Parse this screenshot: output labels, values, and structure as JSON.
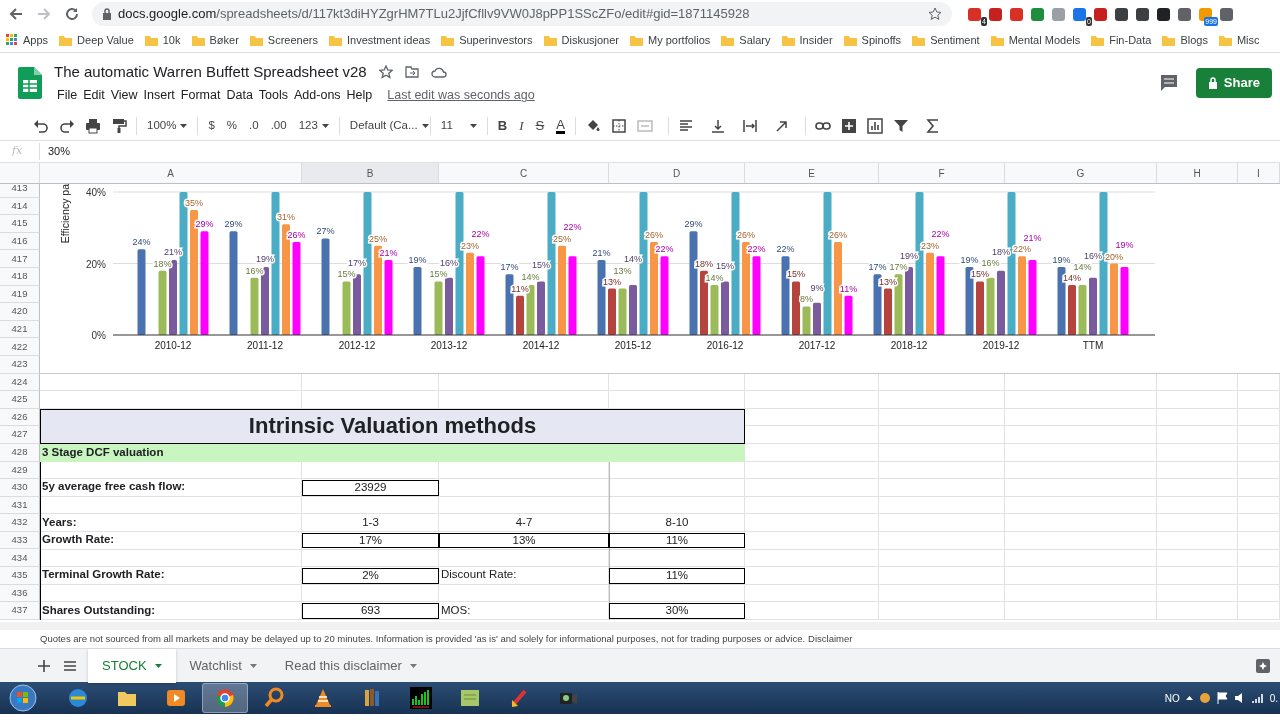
{
  "browser": {
    "url_host": "docs.google.com",
    "url_path": "/spreadsheets/d/117kt3diHYZgrHM7TLu2JjfCfllv9VW0J8pPP1SScZFo/edit#gid=1871145928",
    "extension_badges": [
      "4",
      "0",
      "999"
    ]
  },
  "bookmarks": [
    "Apps",
    "Deep Value",
    "10k",
    "Bøker",
    "Screeners",
    "Investment ideas",
    "Superinvestors",
    "Diskusjoner",
    "My portfolios",
    "Salary",
    "Insider",
    "Spinoffs",
    "Sentiment",
    "Mental Models",
    "Fin-Data",
    "Blogs",
    "Misc"
  ],
  "document": {
    "title": "The automatic Warren Buffett Spreadsheet v28",
    "last_edit": "Last edit was seconds ago",
    "share": "Share"
  },
  "menu": [
    "File",
    "Edit",
    "View",
    "Insert",
    "Format",
    "Data",
    "Tools",
    "Add-ons",
    "Help"
  ],
  "toolbar": {
    "zoom": "100%",
    "currency": "$",
    "percent": "%",
    "decrease_decimals": ".0",
    "increase_decimals": ".00",
    "number_format": "123",
    "font": "Default (Ca...",
    "font_size": "11",
    "bold": "B",
    "italic": "I",
    "strikethrough": "S",
    "text_color": "A"
  },
  "formula_bar": {
    "label": "fx",
    "value": "30%"
  },
  "columns": [
    {
      "label": "A",
      "selected": false
    },
    {
      "label": "B",
      "selected": true
    },
    {
      "label": "C",
      "selected": false
    },
    {
      "label": "D",
      "selected": false
    },
    {
      "label": "E",
      "selected": false
    },
    {
      "label": "F",
      "selected": false
    },
    {
      "label": "G",
      "selected": false
    },
    {
      "label": "H",
      "selected": false
    },
    {
      "label": "I",
      "selected": false
    }
  ],
  "rows": [
    {
      "number": "413"
    },
    {
      "number": "414"
    },
    {
      "number": "415"
    },
    {
      "number": "416"
    },
    {
      "number": "417"
    },
    {
      "number": "418"
    },
    {
      "number": "419"
    },
    {
      "number": "420"
    },
    {
      "number": "421"
    },
    {
      "number": "422"
    },
    {
      "number": "423"
    },
    {
      "number": "424"
    },
    {
      "number": "425"
    },
    {
      "number": "426",
      "cells": {
        "A": {
          "kind": "title",
          "text": "Intrinsic Valuation methods"
        }
      }
    },
    {
      "number": "427"
    },
    {
      "number": "428",
      "cells": {
        "A": {
          "kind": "section",
          "text": "3 Stage DCF valuation"
        }
      }
    },
    {
      "number": "429"
    },
    {
      "number": "430",
      "cells": {
        "A": {
          "kind": "label",
          "text": "5y average free cash flow:"
        },
        "B": {
          "kind": "boxed",
          "text": "23929"
        }
      }
    },
    {
      "number": "431"
    },
    {
      "number": "432",
      "cells": {
        "A": {
          "kind": "label",
          "text": "Years:"
        },
        "B": {
          "kind": "heading",
          "text": "1-3"
        },
        "C": {
          "kind": "heading",
          "text": "4-7"
        },
        "D": {
          "kind": "heading",
          "text": "8-10"
        }
      }
    },
    {
      "number": "433",
      "cells": {
        "A": {
          "kind": "label",
          "text": "Growth Rate:"
        },
        "B": {
          "kind": "boxed",
          "text": "17%"
        },
        "C": {
          "kind": "boxed",
          "text": "13%"
        },
        "D": {
          "kind": "boxed",
          "text": "11%"
        }
      }
    },
    {
      "number": "434"
    },
    {
      "number": "435",
      "cells": {
        "A": {
          "kind": "label",
          "text": "Terminal Growth Rate:"
        },
        "B": {
          "kind": "boxed",
          "text": "2%"
        },
        "C": {
          "kind": "plain",
          "text": "Discount Rate:"
        },
        "D": {
          "kind": "boxed",
          "text": "11%"
        }
      }
    },
    {
      "number": "436"
    },
    {
      "number": "437",
      "cells": {
        "A": {
          "kind": "label",
          "text": "Shares Outstanding:"
        },
        "B": {
          "kind": "boxed",
          "text": "693"
        },
        "C": {
          "kind": "plain",
          "text": "MOS:"
        },
        "D": {
          "kind": "boxed",
          "text": "30%"
        }
      }
    }
  ],
  "chart_data": {
    "type": "bar",
    "ylabel": "Efficiency pa",
    "categories": [
      "2010-12",
      "2011-12",
      "2012-12",
      "2013-12",
      "2014-12",
      "2015-12",
      "2016-12",
      "2017-12",
      "2018-12",
      "2019-12",
      "TTM"
    ],
    "ylim": [
      0,
      40
    ],
    "data_labels": true,
    "yticks": [
      {
        "value": 0,
        "label": "0%"
      },
      {
        "value": 20,
        "label": "20%"
      },
      {
        "value": 40,
        "label": "40%"
      }
    ],
    "series": [
      {
        "color": "#4a72b0",
        "values": [
          24,
          29,
          27,
          19,
          17,
          21,
          29,
          22,
          17,
          19,
          19
        ],
        "value_labels": [
          "24%",
          "29%",
          "27%",
          "19%",
          "17%",
          "21%",
          "29%",
          "22%",
          "17%",
          "19%",
          "19%"
        ]
      },
      {
        "color": "#b5443f",
        "values": [
          null,
          null,
          null,
          null,
          11,
          13,
          18,
          15,
          13,
          15,
          14
        ],
        "value_labels": [
          null,
          null,
          null,
          null,
          "11%",
          "13%",
          "18%",
          "15%",
          "13%",
          "15%",
          "14%"
        ]
      },
      {
        "color": "#9bbb59",
        "values": [
          18,
          16,
          15,
          15,
          14,
          13,
          14,
          8,
          17,
          16,
          14
        ],
        "value_labels": [
          "18%",
          "16%",
          "15%",
          "15%",
          "14%",
          "13%",
          "14%",
          "8%",
          "17%",
          "16%",
          "14%"
        ]
      },
      {
        "color": "#7a5c9e",
        "values": [
          21,
          19,
          17,
          16,
          15,
          14,
          15,
          9,
          19,
          18,
          16
        ],
        "value_labels": [
          "21%",
          "19%",
          "17%",
          "16%",
          "15%",
          "14%",
          "15%",
          "9%",
          "19%",
          "18%",
          "16%"
        ]
      },
      {
        "color": "#4bacc6",
        "values": [
          40,
          40,
          40,
          40,
          40,
          40,
          40,
          40,
          40,
          40,
          40
        ],
        "value_labels": [
          null,
          null,
          null,
          null,
          null,
          null,
          null,
          null,
          null,
          null,
          null
        ]
      },
      {
        "color": "#f79646",
        "values": [
          35,
          31,
          25,
          23,
          25,
          26,
          26,
          26,
          23,
          22,
          20
        ],
        "value_labels": [
          "35%",
          "31%",
          "25%",
          "23%",
          "25%",
          "26%",
          "26%",
          "26%",
          "23%",
          "22%",
          "20%"
        ]
      },
      {
        "color": "#ff00ff",
        "values": [
          29,
          26,
          21,
          22,
          22,
          22,
          22,
          11,
          22,
          21,
          19
        ],
        "value_labels": [
          "29%",
          "26%",
          "21%",
          "22%",
          "22%",
          "22%",
          "22%",
          "11%",
          "22%",
          "21%",
          "19%"
        ]
      }
    ]
  },
  "footer": {
    "notice": "Quotes are not sourced from all markets and may be delayed up to 20 minutes. Information is provided 'as is' and solely for informational purposes, not for trading purposes or advice.",
    "link": "Disclaimer"
  },
  "sheet_tabs": [
    {
      "label": "STOCK",
      "selected": true
    },
    {
      "label": "Watchlist",
      "selected": false
    },
    {
      "label": "Read this disclaimer",
      "selected": false
    }
  ],
  "taskbar": {
    "language": "NO",
    "clock": "0."
  }
}
